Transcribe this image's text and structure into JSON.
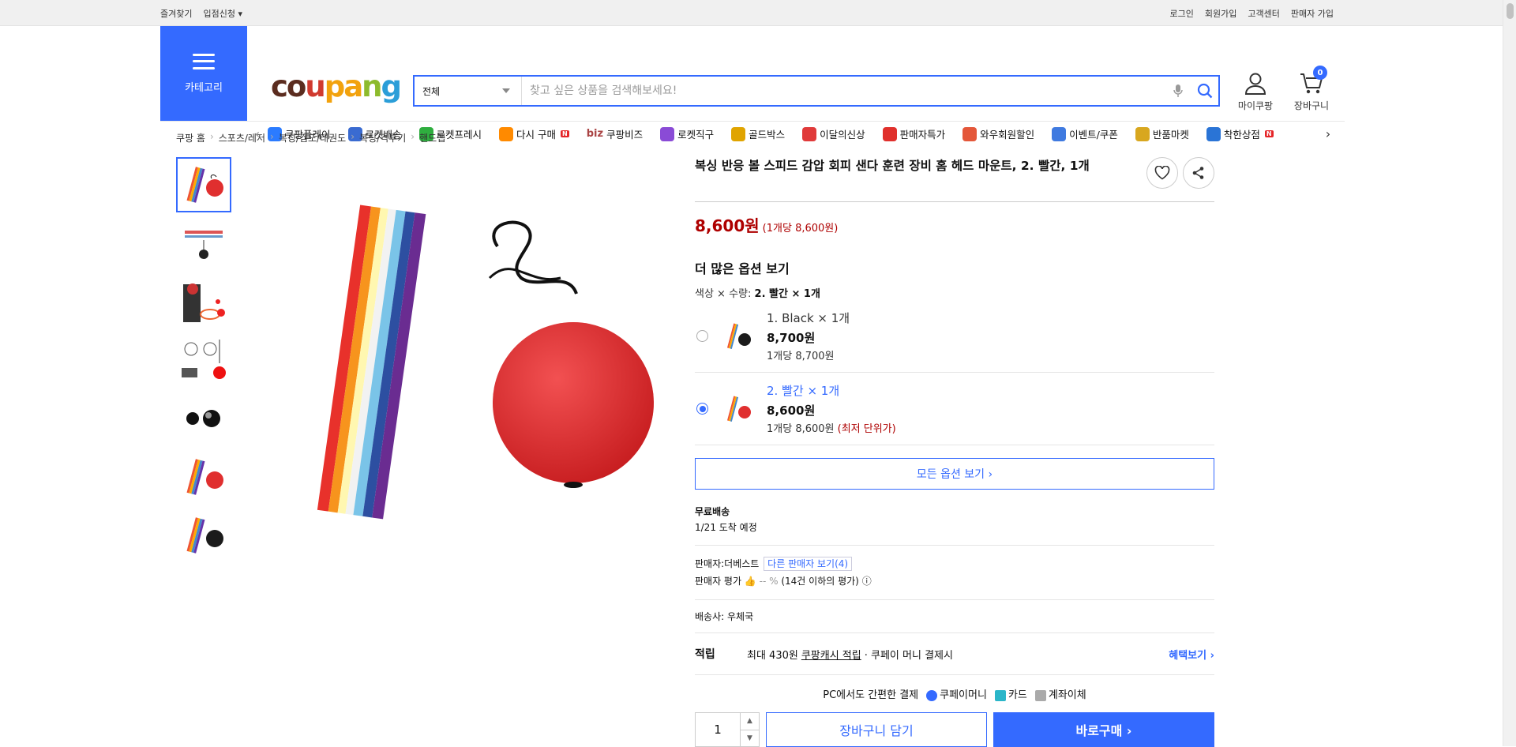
{
  "topbar": {
    "left": [
      "즐겨찾기",
      "입점신청"
    ],
    "right": [
      "로그인",
      "회원가입",
      "고객센터",
      "판매자 가입"
    ]
  },
  "header": {
    "category_label": "카테고리",
    "logo": [
      "co",
      "u",
      "pa",
      "n",
      "g"
    ],
    "search_category": "전체",
    "search_placeholder": "찾고 싶은 상품을 검색해보세요!",
    "mycoupang": "마이쿠팡",
    "cart": "장바구니",
    "cart_count": "0"
  },
  "gnb": [
    {
      "label": "쿠팡플레이",
      "icon": "play-icon",
      "color": "#2b7bff"
    },
    {
      "label": "로켓배송",
      "icon": "rocket-icon",
      "color": "#3a6bd1"
    },
    {
      "label": "로켓프레시",
      "icon": "rocket-fresh-icon",
      "color": "#2fae3f"
    },
    {
      "label": "다시 구매",
      "icon": "rebuy-icon",
      "color": "#ff8a00",
      "badge": "N"
    },
    {
      "label": "쿠팡비즈",
      "icon": "biz-icon",
      "color": "#a44",
      "prefix": "biz"
    },
    {
      "label": "로켓직구",
      "icon": "global-icon",
      "color": "#8a4bd6"
    },
    {
      "label": "골드박스",
      "icon": "goldbox-icon",
      "color": "#e0a400"
    },
    {
      "label": "이달의신상",
      "icon": "new-icon",
      "color": "#e03a3a"
    },
    {
      "label": "판매자특가",
      "icon": "seller-sale-icon",
      "color": "#e0302c"
    },
    {
      "label": "와우회원할인",
      "icon": "wow-icon",
      "color": "#e4573a"
    },
    {
      "label": "이벤트/쿠폰",
      "icon": "coupon-icon",
      "color": "#3f7ae0"
    },
    {
      "label": "반품마켓",
      "icon": "return-icon",
      "color": "#d8a71f"
    },
    {
      "label": "착한상점",
      "icon": "shop-icon",
      "color": "#2a74d6",
      "badge": "N"
    }
  ],
  "breadcrumb": [
    "쿠팡 홈",
    "스포츠/레저",
    "복싱/검도/태권도",
    "복싱/격투기",
    "핸드랩"
  ],
  "product": {
    "title": "복싱 반응 볼 스피드 감압 회피 샌다 훈련 장비 홈 헤드 마운트, 2. 빨간, 1개",
    "price": "8,600원",
    "unit_price": "(1개당 8,600원)",
    "more_options": "더 많은 옵션 보기",
    "option_label": "색상 × 수량:",
    "option_value": "2. 빨간 × 1개",
    "options": [
      {
        "name": "1. Black × 1개",
        "price": "8,700원",
        "unit": "1개당 8,700원",
        "low": "",
        "selected": false
      },
      {
        "name": "2. 빨간 × 1개",
        "price": "8,600원",
        "unit": "1개당 8,600원",
        "low": "(최저 단위가)",
        "selected": true
      }
    ],
    "all_options": "모든 옵션 보기 ›",
    "free_shipping": "무료배송",
    "arrival": "1/21 도착 예정",
    "seller_label": "판매자:",
    "seller_name": "더베스트",
    "other_sellers": "다른 판매자 보기(4)",
    "seller_rating_label": "판매자 평가",
    "seller_rating_value": "-- %",
    "seller_rating_note": "(14건 이하의 평가)",
    "delivery_label": "배송사:",
    "delivery_company": "우체국",
    "reward_label": "적립",
    "reward_prefix": "최대 430원",
    "reward_cash": "쿠팡캐시 적립",
    "reward_suffix": "· 쿠페이 머니 결제시",
    "benefit": "혜택보기 ›",
    "pay_text": "PC에서도 간편한 결제",
    "pay_methods": [
      "쿠페이머니",
      "카드",
      "계좌이체"
    ],
    "quantity": "1",
    "cart_button": "장바구니 담기",
    "buy_button": "바로구매 ›"
  }
}
